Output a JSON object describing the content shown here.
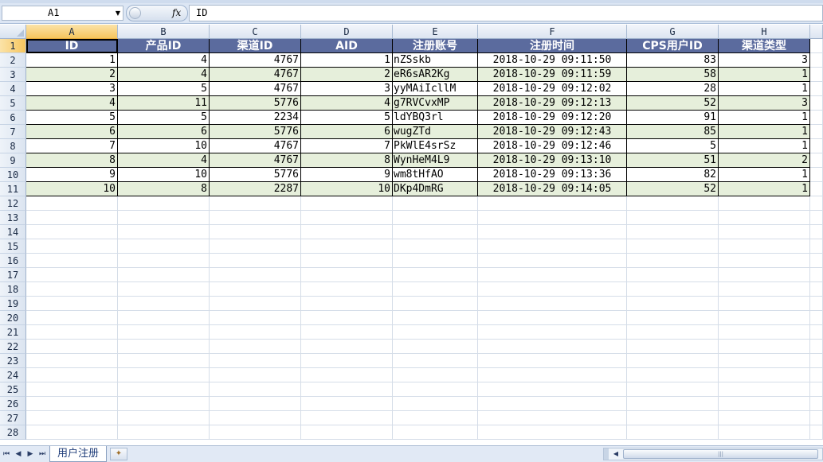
{
  "formula_bar": {
    "name_box": "A1",
    "formula": "ID",
    "fx_label": "fx"
  },
  "columns": [
    "A",
    "B",
    "C",
    "D",
    "E",
    "F",
    "G",
    "H"
  ],
  "rows": [
    "1",
    "2",
    "3",
    "4",
    "5",
    "6",
    "7",
    "8",
    "9",
    "10",
    "11",
    "12",
    "13",
    "14",
    "15",
    "16",
    "17",
    "18",
    "19",
    "20",
    "21",
    "22",
    "23",
    "24",
    "25",
    "26",
    "27",
    "28"
  ],
  "table": {
    "headers": [
      "ID",
      "产品ID",
      "渠道ID",
      "AID",
      "注册账号",
      "注册时间",
      "CPS用户ID",
      "渠道类型"
    ],
    "rows": [
      [
        "1",
        "4",
        "4767",
        "1",
        "nZSskb",
        "2018-10-29 09:11:50",
        "83",
        "3"
      ],
      [
        "2",
        "4",
        "4767",
        "2",
        "eR6sAR2Kg",
        "2018-10-29 09:11:59",
        "58",
        "1"
      ],
      [
        "3",
        "5",
        "4767",
        "3",
        "yyMAiIcllM",
        "2018-10-29 09:12:02",
        "28",
        "1"
      ],
      [
        "4",
        "11",
        "5776",
        "4",
        "g7RVCvxMP",
        "2018-10-29 09:12:13",
        "52",
        "3"
      ],
      [
        "5",
        "5",
        "2234",
        "5",
        "ldYBQ3rl",
        "2018-10-29 09:12:20",
        "91",
        "1"
      ],
      [
        "6",
        "6",
        "5776",
        "6",
        "wugZTd",
        "2018-10-29 09:12:43",
        "85",
        "1"
      ],
      [
        "7",
        "10",
        "4767",
        "7",
        "PkWlE4srSz",
        "2018-10-29 09:12:46",
        "5",
        "1"
      ],
      [
        "8",
        "4",
        "4767",
        "8",
        "WynHeM4L9",
        "2018-10-29 09:13:10",
        "51",
        "2"
      ],
      [
        "9",
        "10",
        "5776",
        "9",
        "wm8tHfAO",
        "2018-10-29 09:13:36",
        "82",
        "1"
      ],
      [
        "10",
        "8",
        "2287",
        "10",
        "DKp4DmRG",
        "2018-10-29 09:14:05",
        "52",
        "1"
      ]
    ]
  },
  "sheet_tabs": [
    "用户注册"
  ],
  "colors": {
    "header_bg": "#5b6b9e",
    "band_bg": "#e6efdb",
    "active_header": "#f6c55e"
  }
}
